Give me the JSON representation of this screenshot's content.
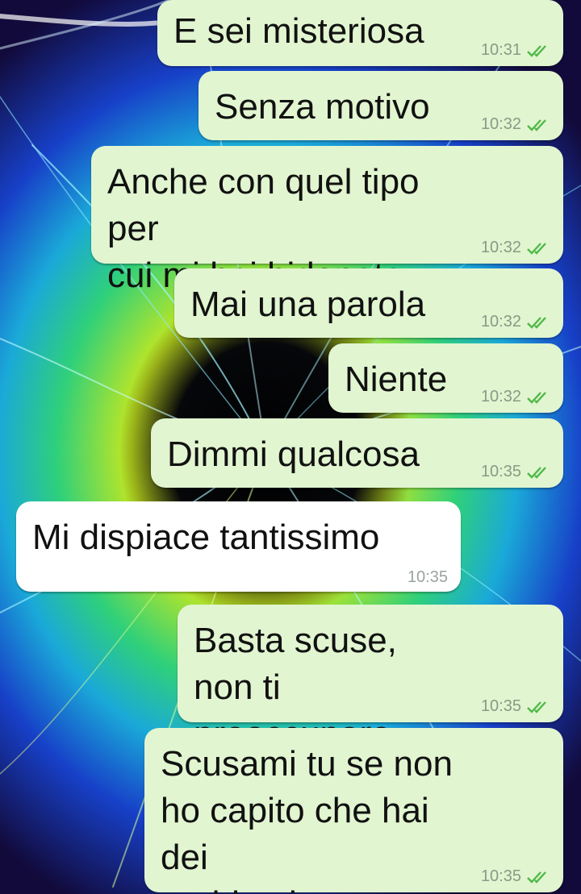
{
  "colors": {
    "outgoing_bubble": "#e1f5d0",
    "incoming_bubble": "#ffffff",
    "read_ticks": "#4fb948"
  },
  "messages": [
    {
      "direction": "outgoing",
      "text": "E sei misteriosa",
      "time": "10:31",
      "status": "read",
      "status_icon": "double-check-icon"
    },
    {
      "direction": "outgoing",
      "text": "Senza motivo",
      "time": "10:32",
      "status": "read",
      "status_icon": "double-check-icon"
    },
    {
      "direction": "outgoing",
      "text": "Anche con quel tipo per\ncui mi hai bidonata",
      "time": "10:32",
      "status": "read",
      "status_icon": "double-check-icon"
    },
    {
      "direction": "outgoing",
      "text": "Mai una parola",
      "time": "10:32",
      "status": "read",
      "status_icon": "double-check-icon"
    },
    {
      "direction": "outgoing",
      "text": "Niente",
      "time": "10:32",
      "status": "read",
      "status_icon": "double-check-icon"
    },
    {
      "direction": "outgoing",
      "text": "Dimmi qualcosa",
      "time": "10:35",
      "status": "read",
      "status_icon": "double-check-icon"
    },
    {
      "direction": "incoming",
      "text": "Mi dispiace tantissimo",
      "time": "10:35"
    },
    {
      "direction": "outgoing",
      "text": "Basta scuse, non ti\npreoccupare",
      "time": "10:35",
      "status": "read",
      "status_icon": "double-check-icon"
    },
    {
      "direction": "outgoing",
      "text": "Scusami tu se non\nho capito che hai dei\nproblemi",
      "time": "10:35",
      "status": "read",
      "status_icon": "double-check-icon"
    }
  ]
}
